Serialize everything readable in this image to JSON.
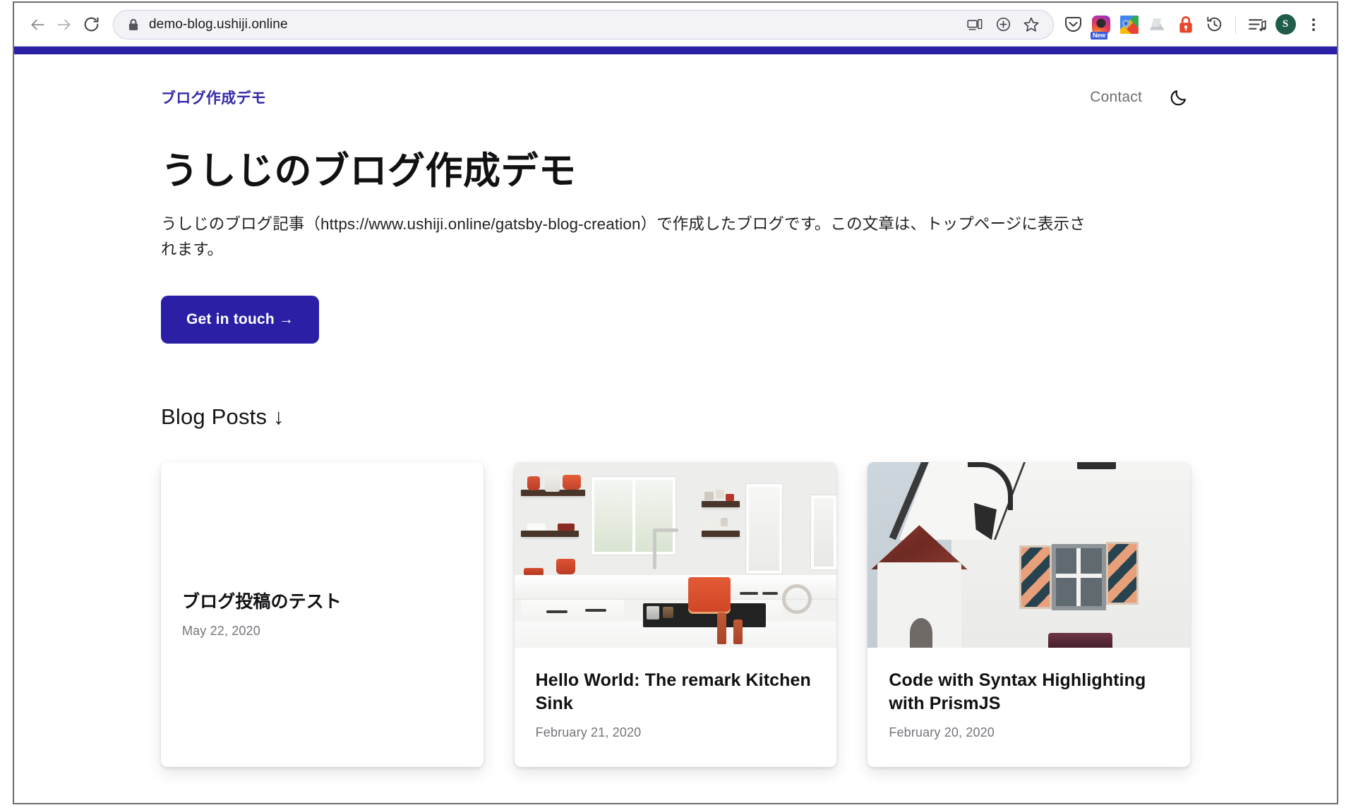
{
  "browser": {
    "back_icon": "back-arrow-icon",
    "forward_icon": "forward-arrow-icon",
    "reload_icon": "reload-icon",
    "lock_icon": "lock-icon",
    "url": "demo-blog.ushiji.online",
    "inner_icons": [
      "device-cast-icon",
      "zoom-add-icon",
      "bookmark-star-icon"
    ],
    "extensions": [
      {
        "name": "pocket-extension-icon",
        "badge": ""
      },
      {
        "name": "instagram-extension-icon",
        "badge": "New"
      },
      {
        "name": "google-maps-extension-icon",
        "badge": ""
      },
      {
        "name": "google-drive-extension-icon",
        "badge": ""
      },
      {
        "name": "lastpass-extension-icon",
        "badge": ""
      },
      {
        "name": "history-extension-icon",
        "badge": ""
      }
    ],
    "media_icon": "media-playlist-icon",
    "avatar_initial": "S",
    "menu_icon": "kebab-menu-icon"
  },
  "site": {
    "accent_color": "#2b1fa6",
    "title": "ブログ作成デモ",
    "nav": {
      "contact_label": "Contact",
      "theme_toggle_icon": "moon-icon"
    }
  },
  "hero": {
    "heading": "うしじのブログ作成デモ",
    "description": "うしじのブログ記事（https://www.ushiji.online/gatsby-blog-creation）で作成したブログです。この文章は、トップページに表示されます。",
    "cta_label": "Get in touch →"
  },
  "posts_section": {
    "heading": "Blog Posts ↓",
    "posts": [
      {
        "title": "ブログ投稿のテスト",
        "date": "May 22, 2020",
        "thumbnail": "none"
      },
      {
        "title": "Hello World: The remark Kitchen Sink",
        "date": "February 21, 2020",
        "thumbnail": "white-kitchen-with-red-pots-photo"
      },
      {
        "title": "Code with Syntax Highlighting with PrismJS",
        "date": "February 20, 2020",
        "thumbnail": "european-building-facade-with-striped-shutters-photo"
      }
    ]
  }
}
